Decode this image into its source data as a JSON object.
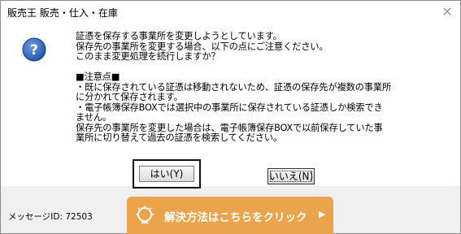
{
  "window": {
    "title": "販売王 販売・仕入・在庫",
    "close_glyph": "✕"
  },
  "dialog": {
    "icon": "question-icon",
    "message": "証憑を保存する事業所を変更しようとしています。\n保存先の事業所を変更する場合、以下の点にご注意ください。\nこのまま変更処理を続行しますか？\n\n■注意点■\n・既に保存されている証憑は移動されないため、証憑の保存先が複数の事業所\nに分かれて保存されます。\n・電子帳簿保存BOXでは選択中の事業所に保存されている証憑しか検索でき\nません。\n保存先の事業所を変更した場合は、電子帳簿保存BOXで以前保存していた事\n業所に切り替えて過去の証憑を検索してください。",
    "yes_label": "はい(Y)",
    "no_label": "いいえ(N)",
    "message_id": "メッセージID: 72503"
  },
  "banner": {
    "label": "解決方法はこちらをクリック",
    "arrow": "▶",
    "icon": "lightbulb-icon",
    "color": "#eba44b"
  }
}
